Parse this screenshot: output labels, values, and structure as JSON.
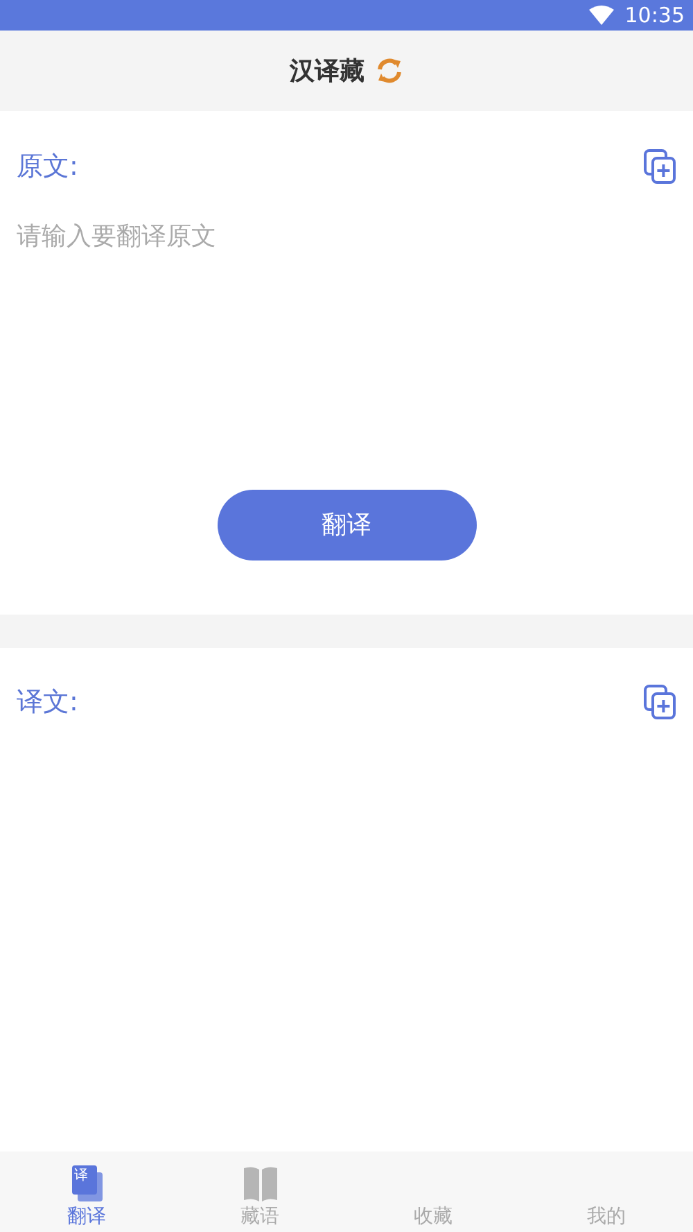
{
  "status_bar": {
    "time": "10:35"
  },
  "header": {
    "title": "汉译藏"
  },
  "source": {
    "label": "原文:",
    "placeholder": "请输入要翻译原文",
    "button": "翻译"
  },
  "result": {
    "label": "译文:"
  },
  "tabs": [
    {
      "label": "翻译",
      "kind": "translate",
      "icon_text": "译",
      "selected": true
    },
    {
      "label": "藏语",
      "kind": "book",
      "selected": false
    },
    {
      "label": "收藏",
      "kind": "none",
      "selected": false
    },
    {
      "label": "我的",
      "kind": "none",
      "selected": false
    }
  ]
}
